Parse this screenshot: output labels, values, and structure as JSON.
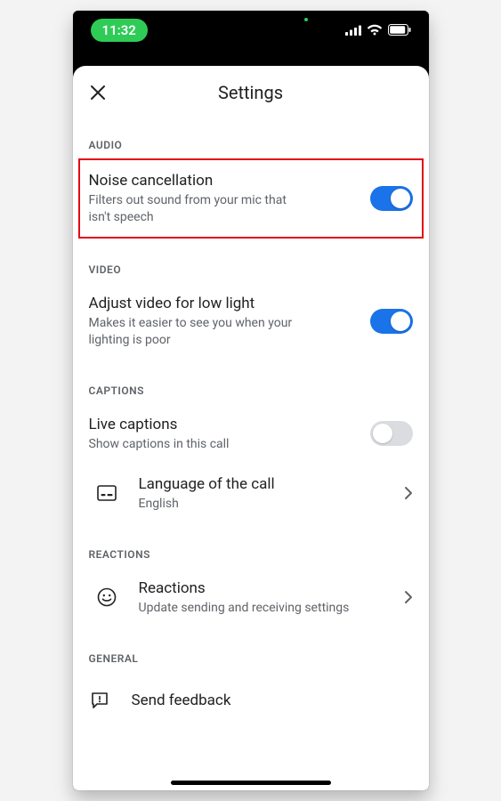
{
  "statusbar": {
    "time": "11:32"
  },
  "header": {
    "title": "Settings"
  },
  "sections": {
    "audio": {
      "header": "AUDIO",
      "noise": {
        "title": "Noise cancellation",
        "sub": "Filters out sound from your mic that isn't speech",
        "on": true
      }
    },
    "video": {
      "header": "VIDEO",
      "lowlight": {
        "title": "Adjust video for low light",
        "sub": "Makes it easier to see you when your lighting is poor",
        "on": true
      }
    },
    "captions": {
      "header": "CAPTIONS",
      "live": {
        "title": "Live captions",
        "sub": "Show captions in this call",
        "on": false
      },
      "language": {
        "title": "Language of the call",
        "sub": "English"
      }
    },
    "reactions": {
      "header": "REACTIONS",
      "item": {
        "title": "Reactions",
        "sub": "Update sending and receiving settings"
      }
    },
    "general": {
      "header": "GENERAL",
      "feedback": {
        "title": "Send feedback"
      }
    }
  }
}
